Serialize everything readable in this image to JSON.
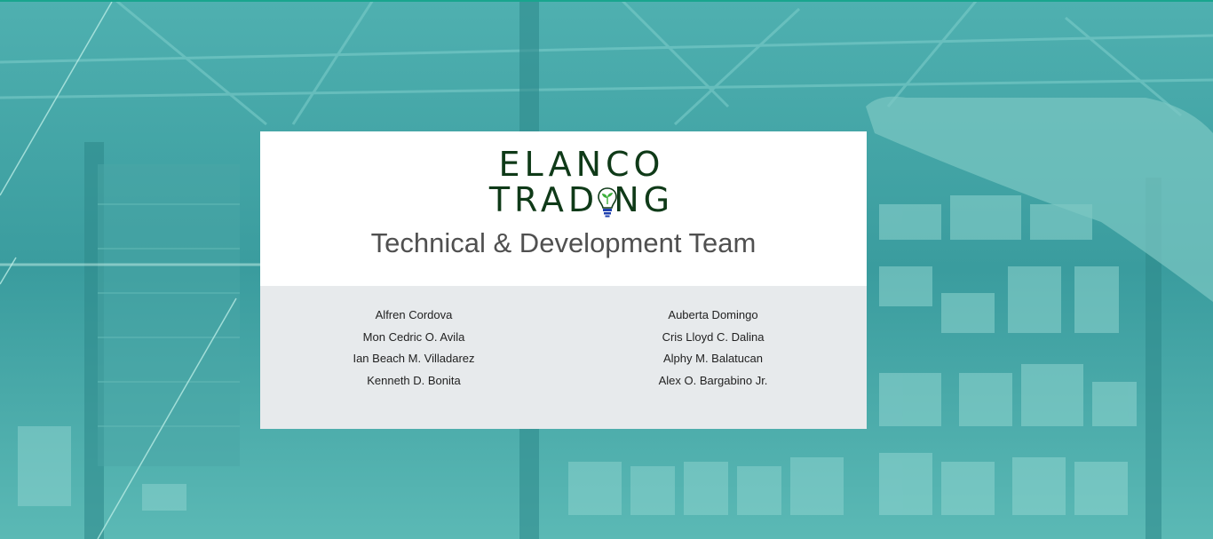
{
  "brand": {
    "line1": "ELANCO",
    "line2": "TRAD NG",
    "logo_colors": {
      "text": "#0f3a18",
      "leaf": "#3cae3a",
      "bulb_base": "#1e3fae"
    }
  },
  "title": "Technical & Development Team",
  "team": {
    "left": [
      "Alfren Cordova",
      "Mon Cedric O. Avila",
      "Ian Beach M. Villadarez",
      "Kenneth D. Bonita"
    ],
    "right": [
      "Auberta Domingo",
      "Cris Lloyd C. Dalina",
      "Alphy M. Balatucan",
      "Alex O. Bargabino Jr."
    ]
  },
  "colors": {
    "background_tint": "#3a9a9c",
    "card_top": "#ffffff",
    "card_bottom": "#e7eaec",
    "accent_line": "#18a58e"
  }
}
